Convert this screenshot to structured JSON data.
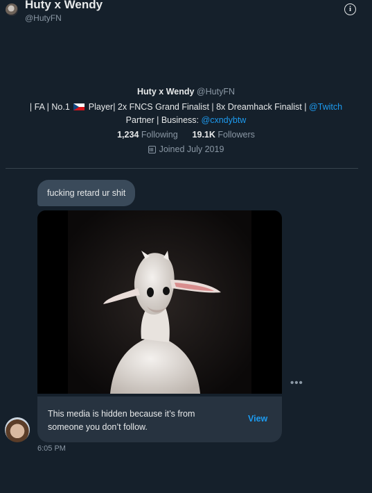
{
  "header": {
    "name": "Huty x Wendy",
    "handle": "@HutyFN",
    "info_icon": "i"
  },
  "profile": {
    "name": "Huty x Wendy",
    "handle": "@HutyFN",
    "bio_part1": "| FA | No.1",
    "bio_part2": "Player| 2x FNCS Grand Finalist | 8x Dreamhack Finalist |",
    "bio_link1": "@Twitch",
    "bio_part3": "Partner | Business:",
    "bio_link2": "@cxndybtw",
    "following_count": "1,234",
    "following_label": "Following",
    "followers_count": "19.1K",
    "followers_label": "Followers",
    "joined": "Joined July 2019"
  },
  "conversation": {
    "message_text": "fucking retard ur shit",
    "hidden_notice": "This media is hidden because it’s from someone you don’t follow.",
    "view_label": "View",
    "more_label": "•••",
    "timestamp": "6:05 PM"
  },
  "colors": {
    "background": "#15202b",
    "accent": "#1d9bf0",
    "bubble": "#3a4a5a",
    "notice_bg": "#273340",
    "muted_text": "#8b98a5"
  }
}
